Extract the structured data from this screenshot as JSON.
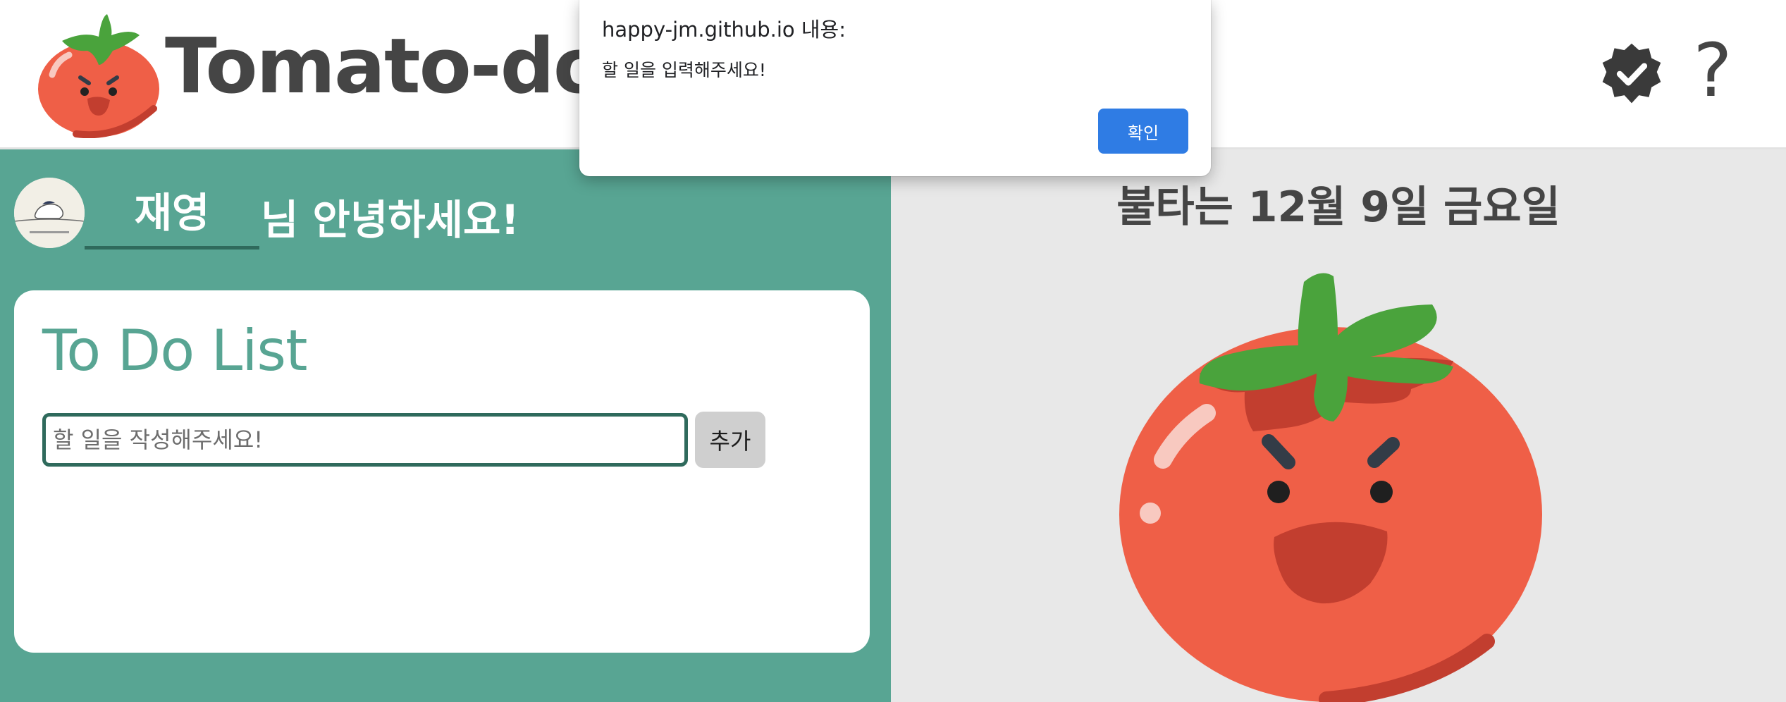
{
  "header": {
    "logo_text": "Tomato-do",
    "help_label": "?"
  },
  "user": {
    "name": "재영",
    "greeting": "님 안녕하세요!"
  },
  "todo": {
    "title": "To Do List",
    "input_placeholder": "할 일을 작성해주세요!",
    "input_value": "",
    "add_label": "추가"
  },
  "date_banner": "불타는 12월 9일 금요일",
  "alert": {
    "title": "happy-jm.github.io 내용:",
    "message": "할 일을 입력해주세요!",
    "ok_label": "확인"
  },
  "colors": {
    "accent_green": "#58a593",
    "dark_green": "#2f6a5c",
    "tomato_red": "#ef5f47",
    "leaf_green": "#4aa33c",
    "text_dark": "#454545",
    "alert_button": "#2f7ce4"
  },
  "icons": {
    "logo": "tomato-icon",
    "badge": "verified-badge-icon",
    "help": "question-icon",
    "avatar": "avatar-illustration"
  }
}
